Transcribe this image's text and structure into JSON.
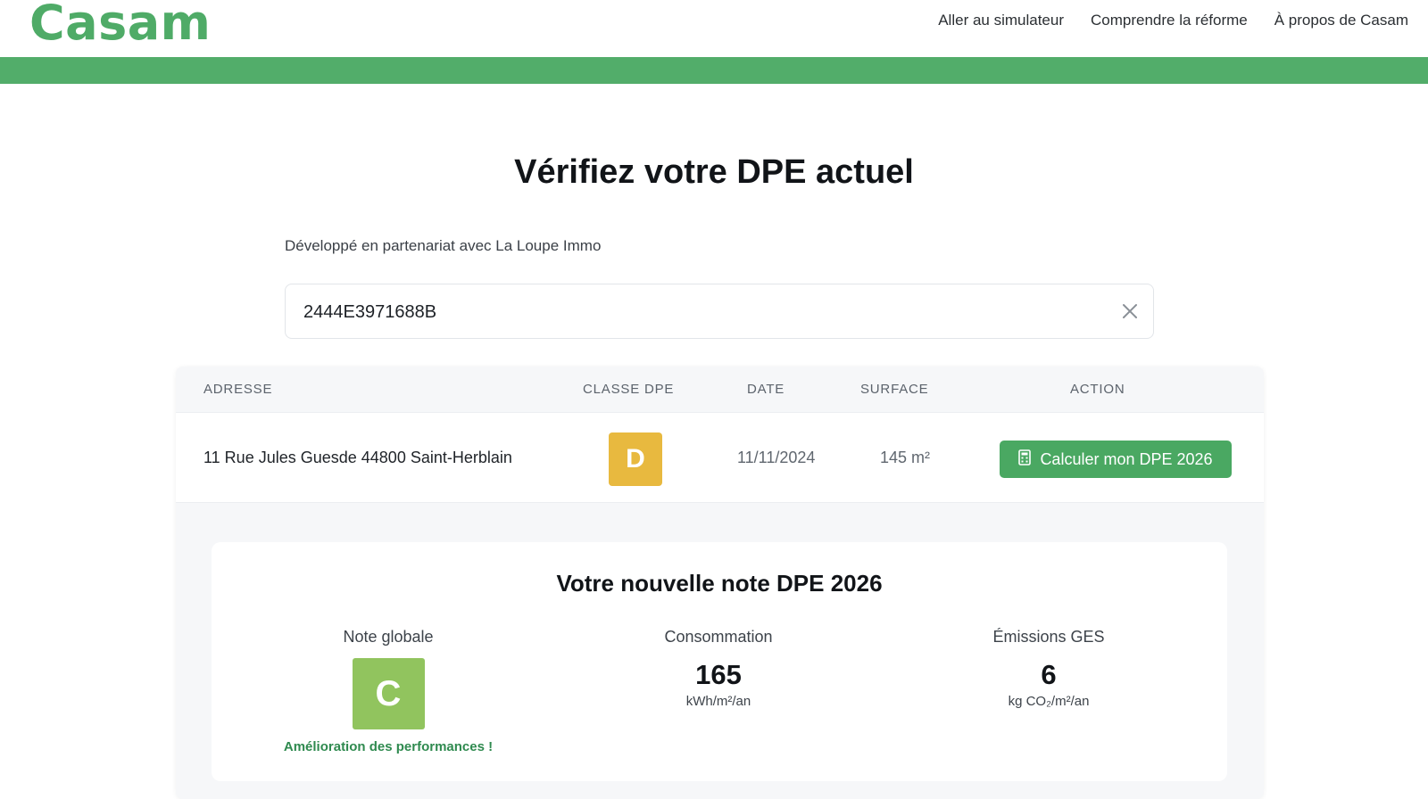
{
  "brand": {
    "logo": "Casam",
    "accent": "#4fab67",
    "bar_color": "#52ad6a"
  },
  "nav": {
    "items": [
      "Aller au simulateur",
      "Comprendre la réforme",
      "À propos de Casam"
    ]
  },
  "page": {
    "title": "Vérifiez votre DPE actuel",
    "subtitle": "Développé en partenariat avec La Loupe Immo"
  },
  "search": {
    "value": "2444E3971688B",
    "clear_icon": "close-icon"
  },
  "table": {
    "headers": [
      "ADRESSE",
      "CLASSE DPE",
      "DATE",
      "SURFACE",
      "ACTION"
    ],
    "rows": [
      {
        "address": "11 Rue Jules Guesde 44800 Saint-Herblain",
        "dpe_class": "D",
        "dpe_color": "#e8b93f",
        "date": "11/11/2024",
        "surface": "145 m²",
        "action_label": "Calculer mon DPE 2026",
        "action_icon": "calculator-icon"
      }
    ]
  },
  "result": {
    "title": "Votre nouvelle note DPE 2026",
    "global": {
      "label": "Note globale",
      "class": "C",
      "class_color": "#91c45e",
      "message": "Amélioration des performances !"
    },
    "consumption": {
      "label": "Consommation",
      "value": "165",
      "unit": "kWh/m²/an"
    },
    "emissions": {
      "label": "Émissions GES",
      "value": "6",
      "unit": "kg CO₂/m²/an"
    }
  }
}
